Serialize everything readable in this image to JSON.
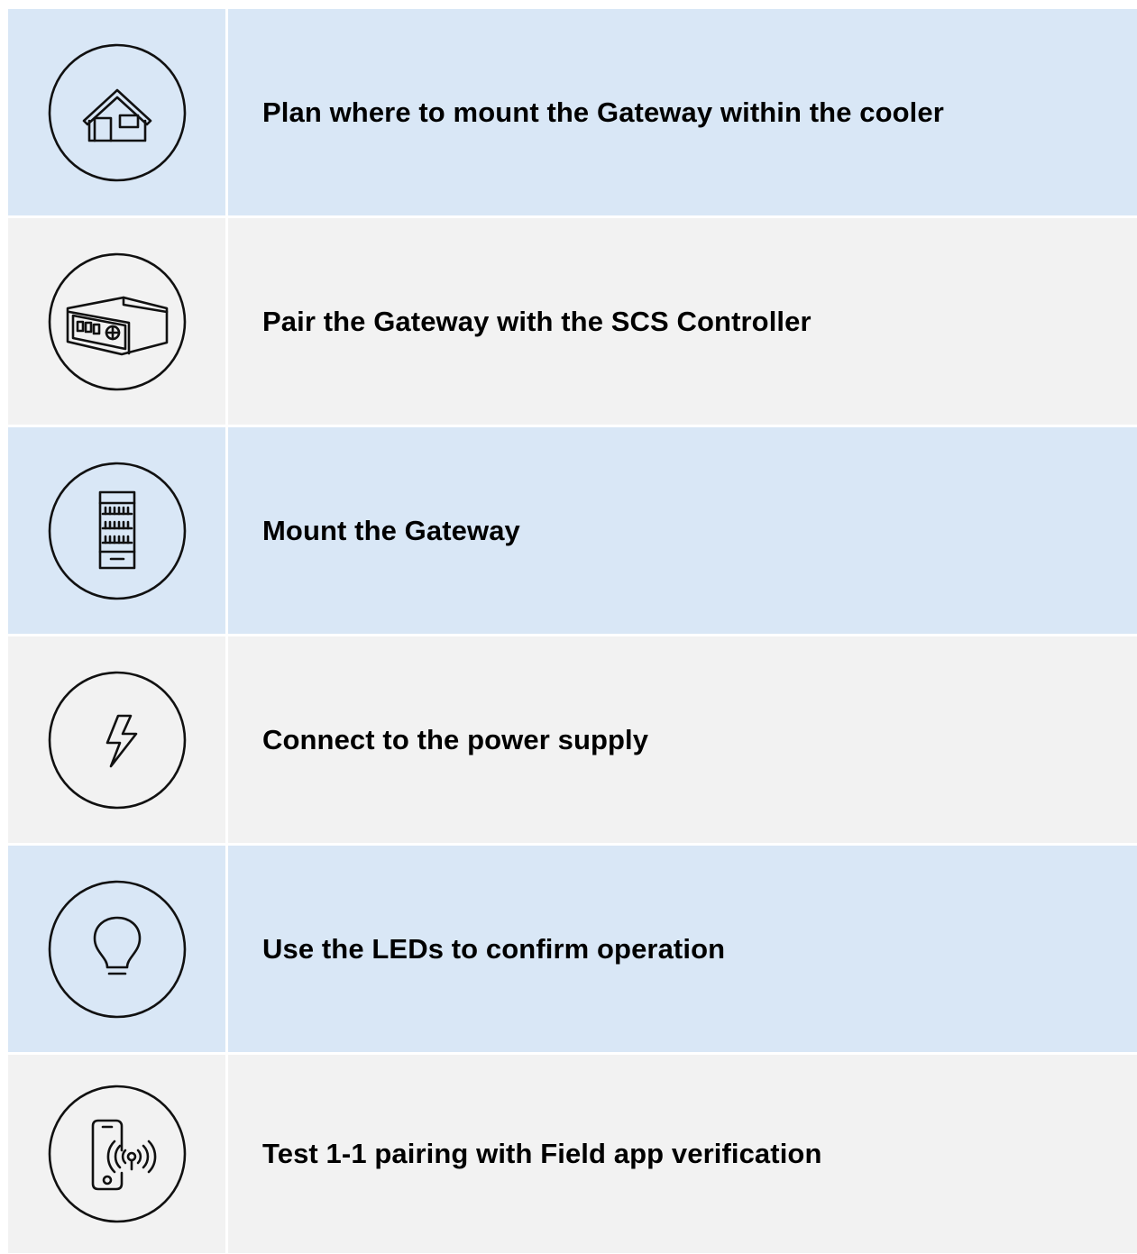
{
  "steps": [
    {
      "icon": "house-icon",
      "label": "Plan where to mount the Gateway within the cooler"
    },
    {
      "icon": "controller-icon",
      "label": "Pair the Gateway with the SCS Controller"
    },
    {
      "icon": "cooler-icon",
      "label": "Mount the Gateway"
    },
    {
      "icon": "lightning-icon",
      "label": "Connect to the power supply"
    },
    {
      "icon": "lightbulb-icon",
      "label": "Use the LEDs to confirm operation"
    },
    {
      "icon": "phone-signal-icon",
      "label": "Test 1-1 pairing with Field app verification"
    }
  ],
  "colors": {
    "row_blue": "#d9e7f6",
    "row_grey": "#f2f2f2",
    "text": "#000000"
  }
}
